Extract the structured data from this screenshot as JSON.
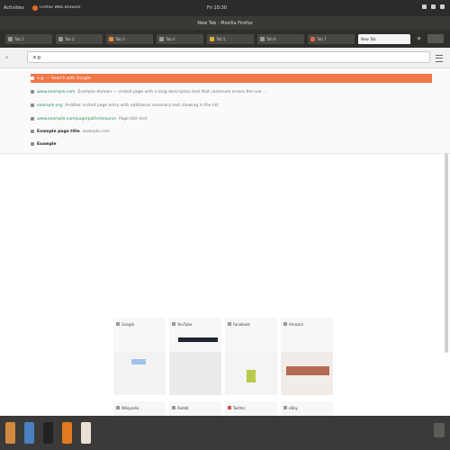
{
  "top_panel": {
    "activities": "Activities",
    "app_name": "Firefox Web Browser",
    "clock": "Fri 10:30"
  },
  "window": {
    "title": "New Tab - Mozilla Firefox"
  },
  "tabs": [
    {
      "label": "Tab 1"
    },
    {
      "label": "Tab 2"
    },
    {
      "label": "Tab 3"
    },
    {
      "label": "Tab 4"
    },
    {
      "label": "Tab 5"
    },
    {
      "label": "Tab 6"
    },
    {
      "label": "Tab 7"
    },
    {
      "label": "New Tab"
    }
  ],
  "nav": {
    "back_symbol": "‹",
    "url_value": "e.g.",
    "new_tab_symbol": "+"
  },
  "suggestions": [
    {
      "text": "e.g. — Search with Google",
      "url": "",
      "desc": ""
    },
    {
      "title": "",
      "url": "www.example.com",
      "desc": "Example domain — visited page with a long description text that continues across the row …"
    },
    {
      "title": "",
      "url": "example.org",
      "desc": "Another visited page entry with additional summary text showing in the list"
    },
    {
      "title": "",
      "url": "www.example.com/page/path/resource",
      "desc": "Page title text"
    },
    {
      "title": "Example page title",
      "url": "",
      "desc": "example.com"
    },
    {
      "title": "Example",
      "url": "",
      "desc": ""
    }
  ],
  "top_sites": [
    {
      "label": "Google"
    },
    {
      "label": "YouTube"
    },
    {
      "label": "Facebook"
    },
    {
      "label": "Amazon"
    }
  ],
  "top_sites_row2": [
    {
      "label": "Wikipedia"
    },
    {
      "label": "Reddit"
    },
    {
      "label": "Twitter"
    },
    {
      "label": "eBay"
    }
  ],
  "colors": {
    "accent": "#f07746",
    "panel": "#2b2b29",
    "url_green": "#2e8b57"
  }
}
